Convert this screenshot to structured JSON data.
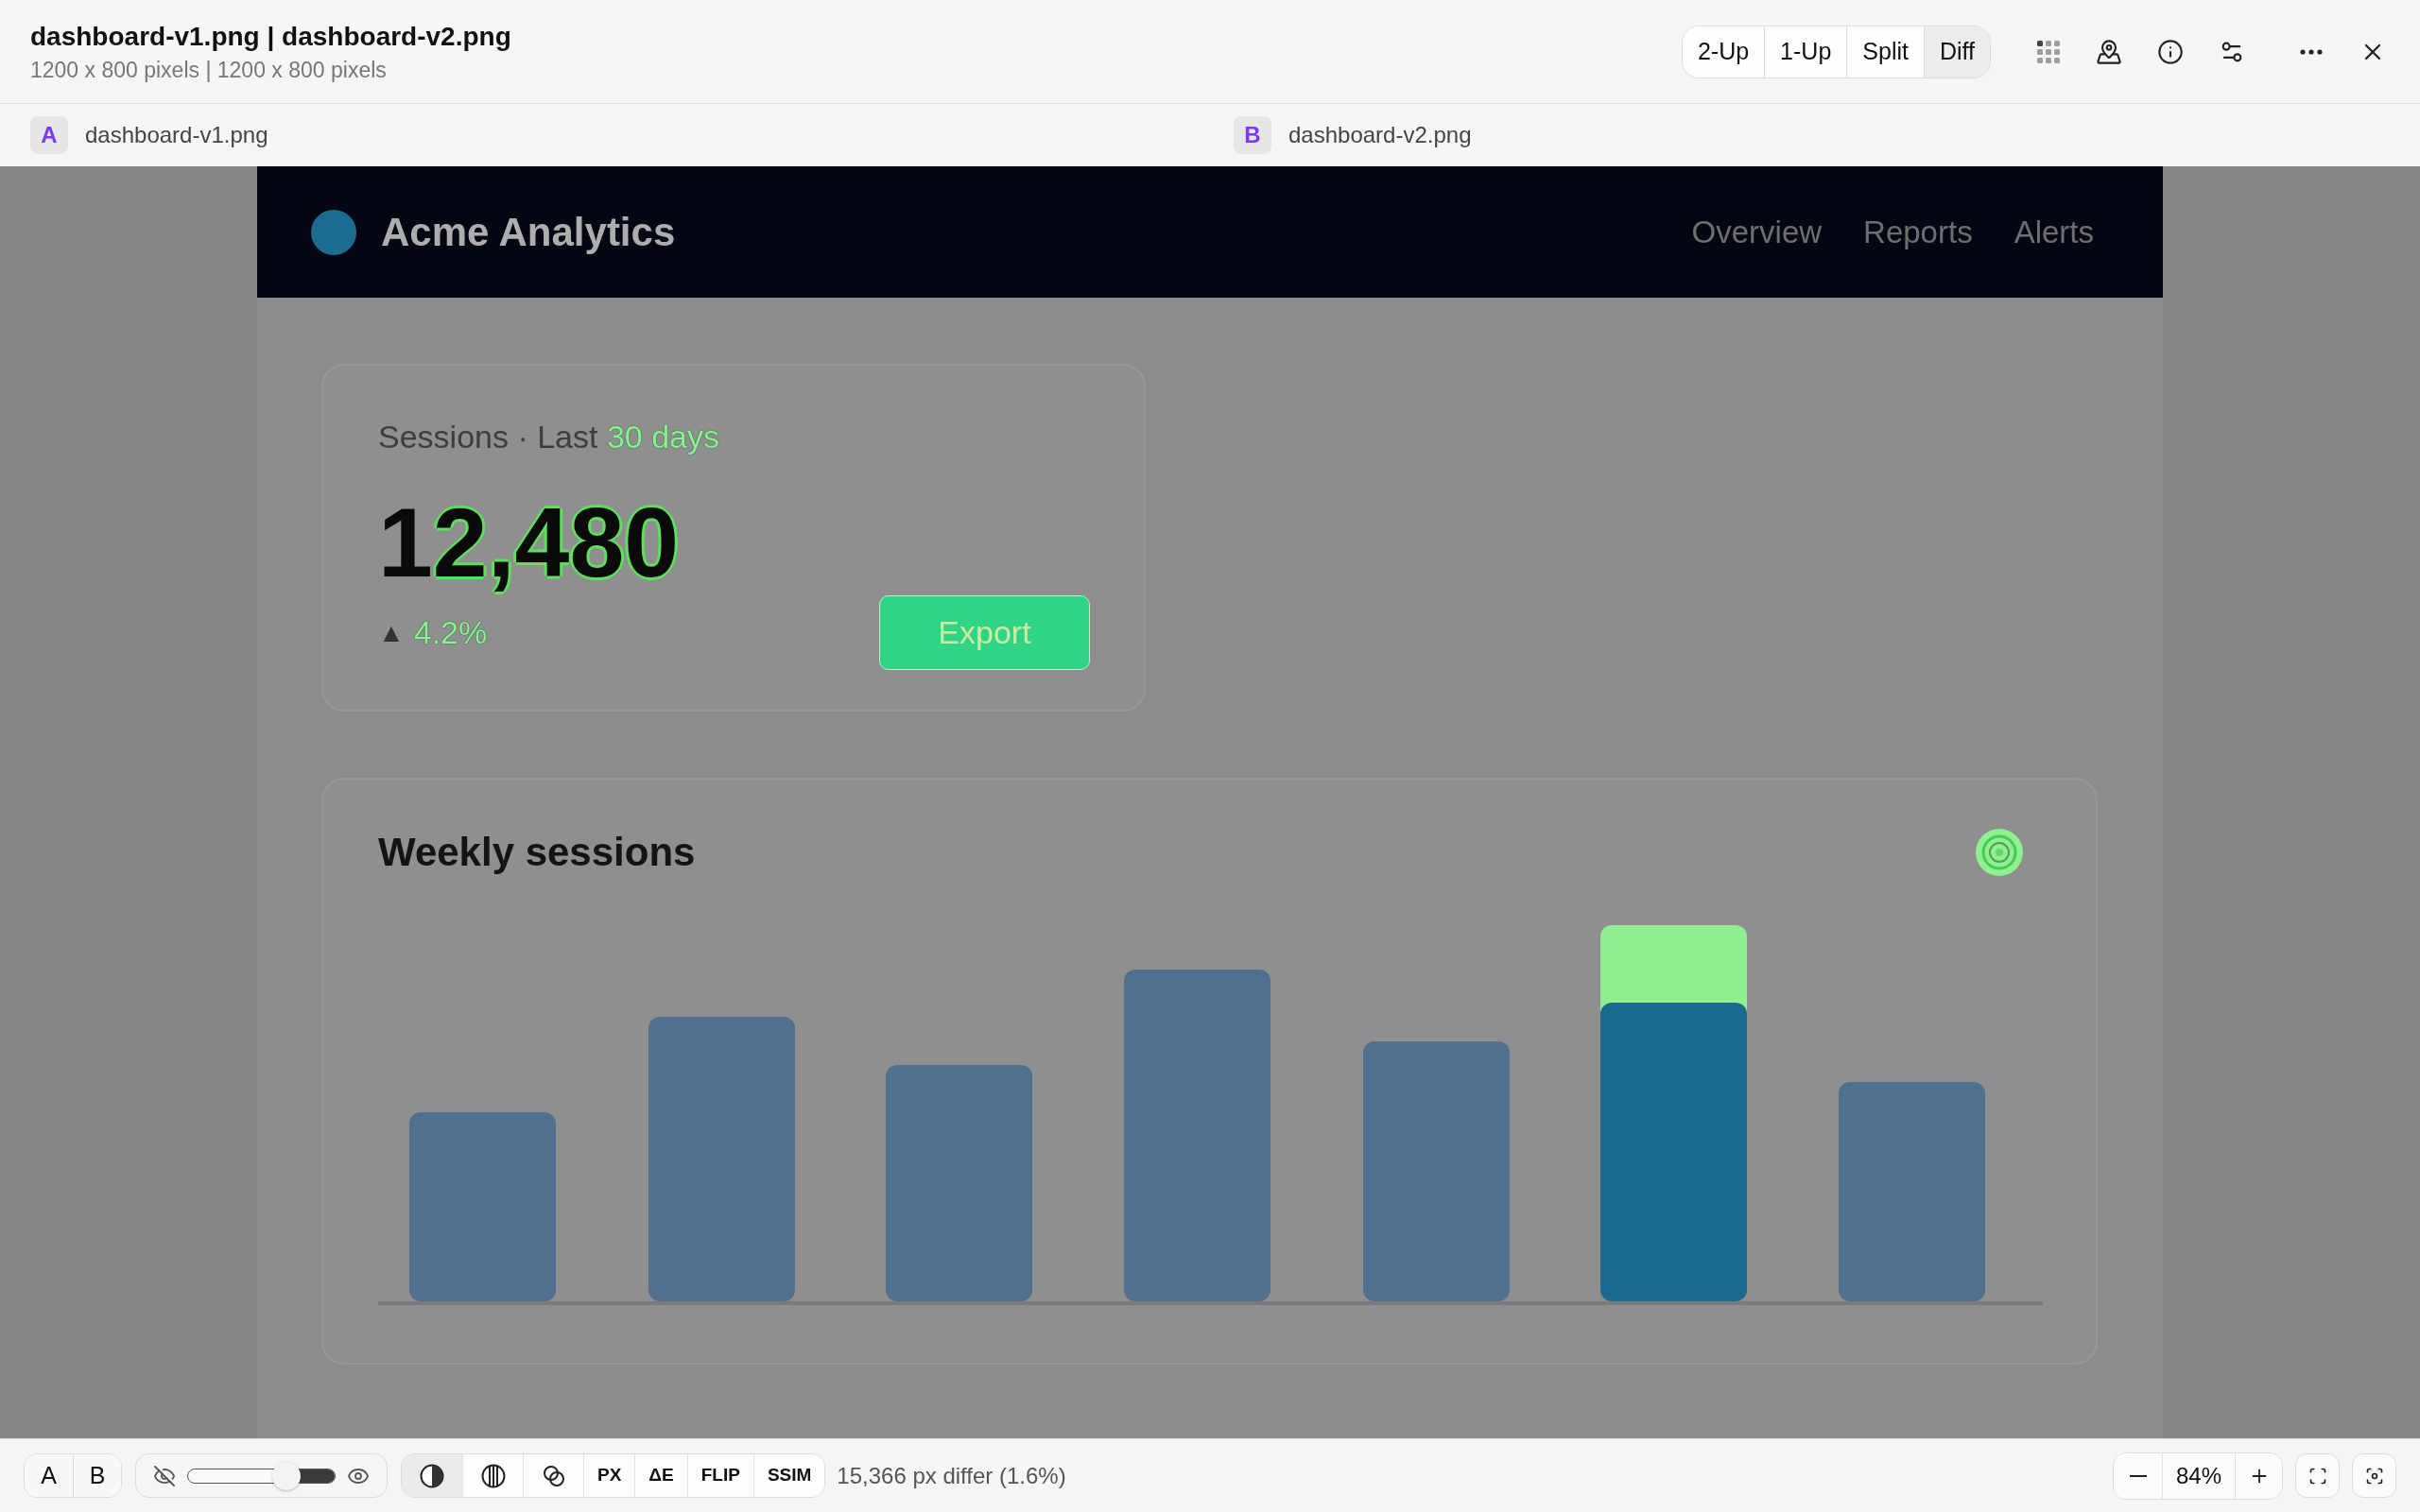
{
  "window": {
    "title": "dashboard-v1.png | dashboard-v2.png",
    "subtitle": "1200 x 800 pixels | 1200 x 800 pixels"
  },
  "view_modes": [
    {
      "label": "2-Up",
      "selected": false
    },
    {
      "label": "1-Up",
      "selected": false
    },
    {
      "label": "Split",
      "selected": false
    },
    {
      "label": "Diff",
      "selected": true
    }
  ],
  "images": [
    {
      "badge": "A",
      "filename": "dashboard-v1.png"
    },
    {
      "badge": "B",
      "filename": "dashboard-v2.png"
    }
  ],
  "dashboard": {
    "brand": "Acme Analytics",
    "nav": [
      "Overview",
      "Reports",
      "Alerts"
    ],
    "sessions_card": {
      "label": [
        {
          "text": "Sessions · Last ",
          "changed": false
        },
        {
          "text": "30 days",
          "changed": true
        }
      ],
      "value": [
        {
          "text": "1",
          "changed": false
        },
        {
          "text": "2,480",
          "changed": true
        }
      ],
      "delta": {
        "arrow": "▲",
        "value": "4.2%",
        "changed": true
      },
      "export_button": {
        "label": "Export",
        "changed": true
      }
    },
    "weekly_card": {
      "title": "Weekly sessions",
      "icon": {
        "changed": true
      },
      "chart": {
        "changed": true
      }
    }
  },
  "bottom_bar": {
    "sources": [
      "A",
      "B"
    ],
    "blend": {
      "level": 0.67
    },
    "modes": [
      {
        "kind": "icon",
        "selected": true
      },
      {
        "kind": "icon",
        "selected": false
      },
      {
        "kind": "icon",
        "selected": false
      },
      {
        "kind": "text",
        "label": "PX",
        "selected": false
      },
      {
        "kind": "text",
        "label": "ΔE",
        "selected": false
      },
      {
        "kind": "text",
        "label": "FLIP",
        "selected": false
      },
      {
        "kind": "text",
        "label": "SSIM",
        "selected": false
      }
    ],
    "diff_summary": "15,366 px differ (1.6%)",
    "zoom": {
      "value": "84%"
    }
  }
}
